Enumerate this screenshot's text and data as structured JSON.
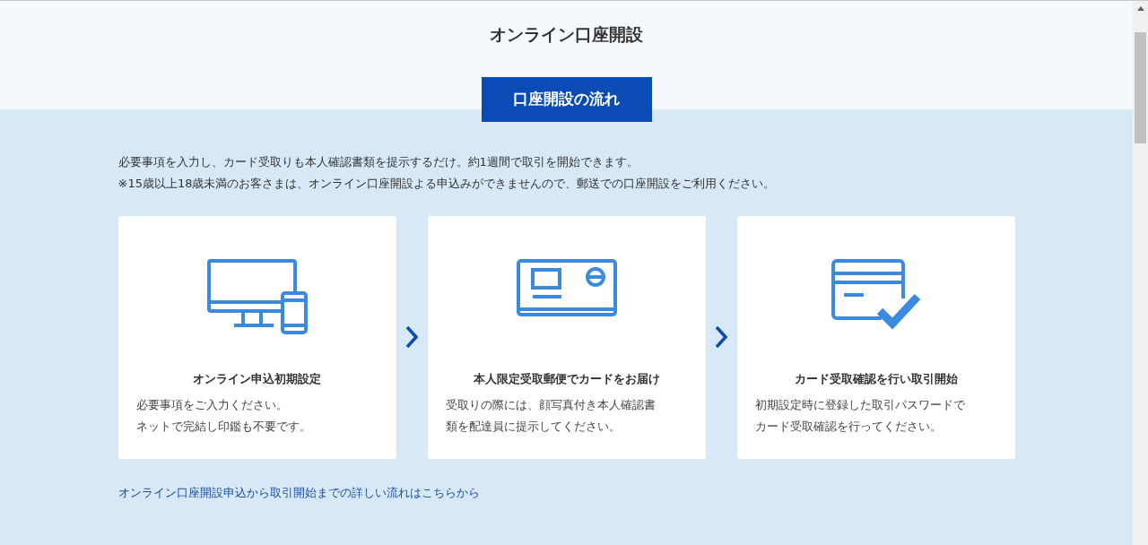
{
  "page_title": "オンライン口座開設",
  "section_button": "口座開設の流れ",
  "intro": [
    "必要事項を入力し、カード受取りも本人確認書類を提示するだけ。約1週間で取引を開始できます。",
    "※15歳以上18歳未満のお客さまは、オンライン口座開設よる申込みができませんので、郵送での口座開設をご利用ください。"
  ],
  "steps": [
    {
      "kind": "devices",
      "title": "オンライン申込初期設定",
      "description": [
        "必要事項をご入力ください。",
        "ネットで完結し印鑑も不要です。"
      ]
    },
    {
      "kind": "card",
      "title": "本人限定受取郵便でカードをお届け",
      "description": [
        "受取りの際には、顔写真付き本人確認書",
        "類を配達員に提示してください。"
      ]
    },
    {
      "kind": "card-check",
      "title": "カード受取確認を行い取引開始",
      "description": [
        "初期設定時に登録した取引パスワードで",
        "カード受取確認を行ってください。"
      ]
    }
  ],
  "link": "オンライン口座開設申込から取引開始までの詳しい流れはこちらから"
}
